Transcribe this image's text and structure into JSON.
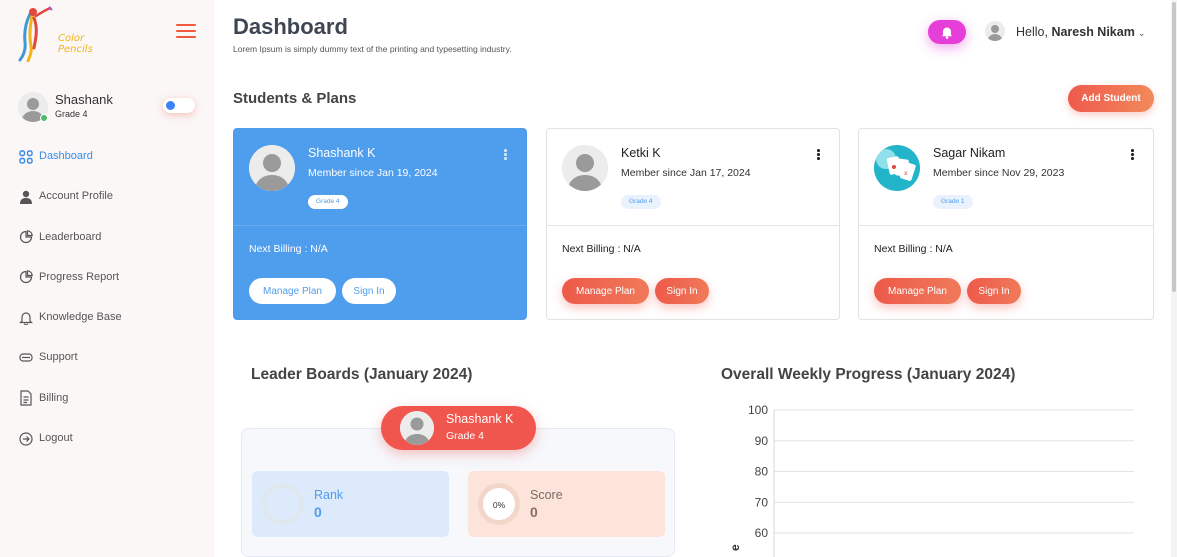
{
  "brand": {
    "logo_text": "Color Pencils"
  },
  "sidebar": {
    "profile": {
      "name": "Shashank",
      "grade": "Grade 4",
      "online_color": "#4cbb6c"
    },
    "items": [
      {
        "label": "Dashboard",
        "icon": "dashboard-grid-icon",
        "active": true
      },
      {
        "label": "Account Profile",
        "icon": "user-icon",
        "active": false
      },
      {
        "label": "Leaderboard",
        "icon": "pie-chart-icon",
        "active": false
      },
      {
        "label": "Progress Report",
        "icon": "pie-chart-icon",
        "active": false
      },
      {
        "label": "Knowledge Base",
        "icon": "bell-icon",
        "active": false
      },
      {
        "label": "Support",
        "icon": "chat-icon",
        "active": false
      },
      {
        "label": "Billing",
        "icon": "document-icon",
        "active": false
      },
      {
        "label": "Logout",
        "icon": "logout-icon",
        "active": false
      }
    ]
  },
  "header": {
    "title": "Dashboard",
    "subtitle": "Lorem Ipsum is simply dummy text of the printing and typesetting industry.",
    "greeting": "Hello,",
    "user_name": "Naresh Nikam",
    "notification_color": "#e63ed9"
  },
  "students": {
    "section_title": "Students & Plans",
    "add_label": "Add Student",
    "cards": [
      {
        "name": "Shashank K",
        "since": "Member since Jan 19, 2024",
        "grade": "Grade 4",
        "billing": "Next Billing : N/A",
        "manage": "Manage Plan",
        "sign_in": "Sign In",
        "selected": true
      },
      {
        "name": "Ketki K",
        "since": "Member since Jan 17, 2024",
        "grade": "Grade 4",
        "billing": "Next Billing : N/A",
        "manage": "Manage Plan",
        "sign_in": "Sign In",
        "selected": false
      },
      {
        "name": "Sagar Nikam",
        "since": "Member since Nov 29, 2023",
        "grade": "Grade 1",
        "billing": "Next Billing : N/A",
        "manage": "Manage Plan",
        "sign_in": "Sign In",
        "selected": false
      }
    ]
  },
  "leaderboard": {
    "title": "Leader Boards (January 2024)",
    "top": {
      "name": "Shashank K",
      "grade": "Grade 4"
    },
    "rank_label": "Rank",
    "rank_value": "0",
    "score_label": "Score",
    "score_value": "0",
    "score_percent": "0%"
  },
  "progress": {
    "title": "Overall Weekly Progress (January 2024)"
  },
  "chart_data": {
    "type": "line",
    "title": "Overall Weekly Progress (January 2024)",
    "y_ticks": [
      "100",
      "90",
      "80",
      "70",
      "60"
    ],
    "ylim": [
      60,
      100
    ],
    "ylabel_visible_fragment": "e",
    "series": [],
    "grid": true
  },
  "colors": {
    "accent": "#4f9ded",
    "brand_red": "#f0564d",
    "sidebar_bg": "#fbf7f7"
  }
}
